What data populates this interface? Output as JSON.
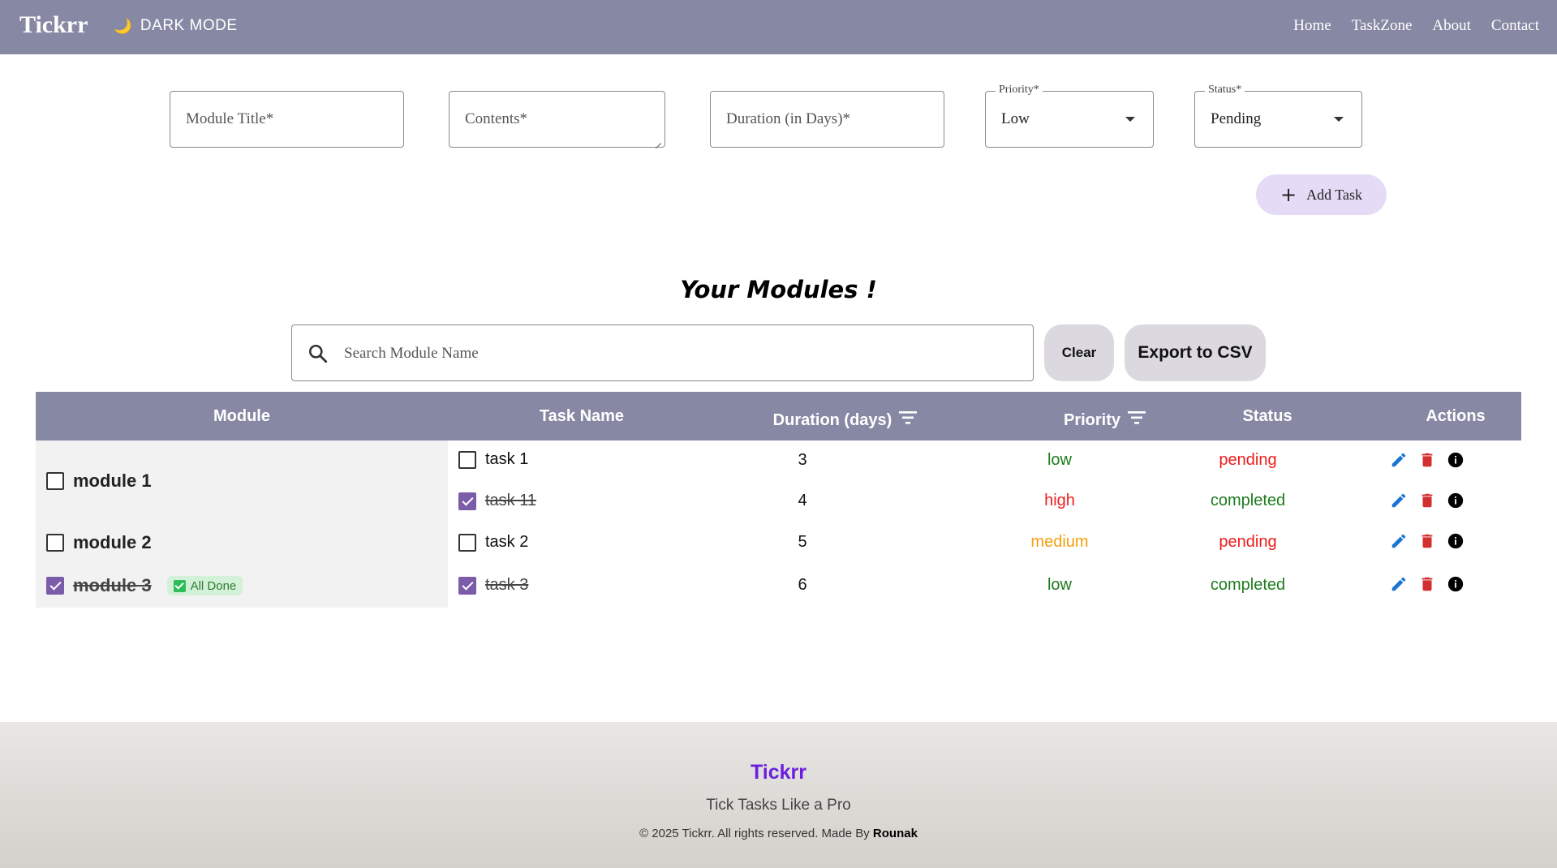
{
  "nav": {
    "brand": "Tickrr",
    "dark_mode_label": "DARK MODE",
    "links": [
      "Home",
      "TaskZone",
      "About",
      "Contact"
    ]
  },
  "form": {
    "module_title_placeholder": "Module Title*",
    "contents_placeholder": "Contents*",
    "duration_placeholder": "Duration (in Days)*",
    "priority_label": "Priority*",
    "priority_value": "Low",
    "status_label": "Status*",
    "status_value": "Pending",
    "add_task_label": "Add Task"
  },
  "section_title": "Your Modules !",
  "search": {
    "placeholder": "Search Module Name",
    "clear_label": "Clear",
    "export_label": "Export to CSV"
  },
  "table": {
    "headers": [
      "Module",
      "Task Name",
      "Duration (days)",
      "Priority",
      "Status",
      "Actions"
    ],
    "modules": [
      {
        "name": "module 1",
        "checked": false,
        "all_done": false
      },
      {
        "name": "module 2",
        "checked": false,
        "all_done": false
      },
      {
        "name": "module 3",
        "checked": true,
        "all_done": true,
        "badge": "All Done"
      }
    ],
    "rows": [
      {
        "task": "task 1",
        "checked": false,
        "duration": "3",
        "priority": "low",
        "status": "pending"
      },
      {
        "task": "task 11",
        "checked": true,
        "duration": "4",
        "priority": "high",
        "status": "completed"
      },
      {
        "task": "task 2",
        "checked": false,
        "duration": "5",
        "priority": "medium",
        "status": "pending"
      },
      {
        "task": "task 3",
        "checked": true,
        "duration": "6",
        "priority": "low",
        "status": "completed"
      }
    ]
  },
  "colors": {
    "nav_bg": "#8789a4",
    "priority_low": "#1e7b1e",
    "priority_high": "#ee1c1c",
    "priority_medium": "#f5a00f",
    "status_pending": "#ee1c1c",
    "status_completed": "#1e7b1e",
    "edit_icon": "#1976d2",
    "delete_icon": "#d32f2f",
    "info_icon": "#000000",
    "footer_brand": "#6a1fe0"
  },
  "footer": {
    "brand": "Tickrr",
    "tagline": "Tick Tasks Like a Pro",
    "copyright": "© 2025 Tickrr. All rights reserved. Made By",
    "author": "Rounak"
  }
}
